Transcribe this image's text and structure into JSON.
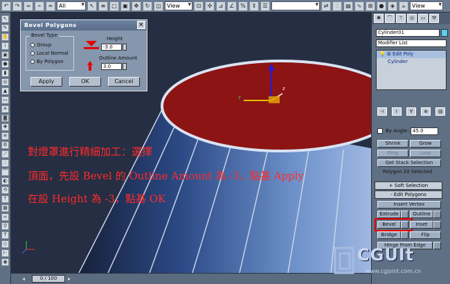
{
  "topbar": {
    "select_filter": "All",
    "view_combo_1": "View",
    "view_combo_2": "View"
  },
  "dialog": {
    "title": "Bevel Polygons",
    "bevel_type_label": "Bevel Type",
    "options": [
      "Group",
      "Local Normal",
      "By Polygon"
    ],
    "height_label": "Height",
    "height_value": "-3.0",
    "outline_label": "Outline Amount",
    "outline_value": "3.0",
    "apply": "Apply",
    "ok": "OK",
    "cancel": "Cancel"
  },
  "instructions": [
    "對燈罩進行精細加工：選擇",
    "頂面，先設 Bevel 的 Outline Amount 為 -3，點基 Apply",
    "在設 Height 為 -3，點基 OK"
  ],
  "right_panel": {
    "object_name": "Cylinder01",
    "modifier_list": "Modifier List",
    "stack": [
      "Edit Poly",
      "Cylinder"
    ],
    "by_angle_label": "By Angle:",
    "by_angle_value": "45.0",
    "shrink": "Shrink",
    "grow": "Grow",
    "ring": "Ring",
    "loop": "Loop",
    "get_stack_selection": "Get Stack Selection",
    "selection_info": "Polygon 20 Selected",
    "soft_selection": "Soft Selection",
    "edit_polygons": "Edit Polygons",
    "insert_vertex": "Insert Vertex",
    "extrude": "Extrude",
    "outline": "Outline",
    "bevel": "Bevel",
    "inset": "Inset",
    "bridge": "Bridge",
    "flip": "Flip",
    "hinge_from_edge": "Hinge From Edge",
    "plus_sign": "+",
    "minus_sign": "-"
  },
  "status": {
    "time": "0 / 100"
  },
  "watermark": {
    "brand": "CGUIt",
    "url": "www.cgjoint.com.cn"
  },
  "colors": {
    "top_face": "#8c1414",
    "viewport_bg": "#252e42",
    "instruction_text": "#ff2b2b",
    "highlight": "#e60000"
  }
}
